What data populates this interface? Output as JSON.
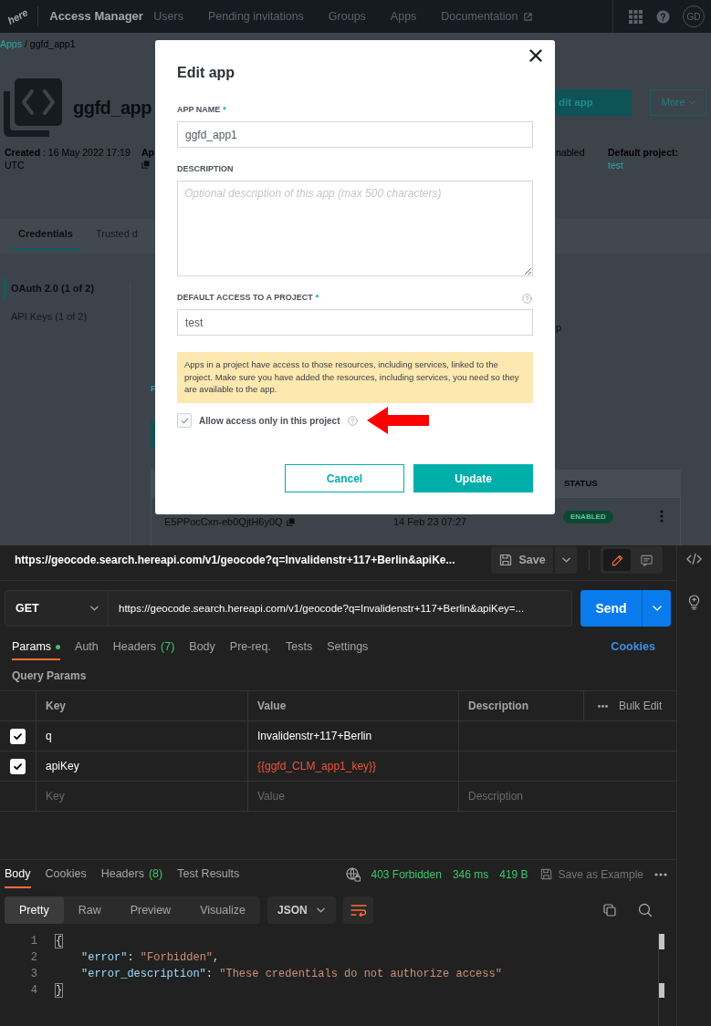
{
  "access_manager": {
    "nav": {
      "logo": "here",
      "title": "Access Manager",
      "links": [
        {
          "label": "Users",
          "external": false
        },
        {
          "label": "Pending invitations",
          "external": false
        },
        {
          "label": "Groups",
          "external": false
        },
        {
          "label": "Apps",
          "external": false
        },
        {
          "label": "Documentation",
          "external": true
        }
      ],
      "avatar": "GD"
    },
    "breadcrumb": {
      "items": [
        "Apps",
        "ggfd_app1"
      ],
      "separator": "/"
    },
    "app": {
      "title": "ggfd_app",
      "buttons": [
        {
          "label": "dit app",
          "kind": "primary"
        },
        {
          "label": "More",
          "kind": "menu"
        }
      ]
    },
    "meta": {
      "created": "**Created** : 16 May 2022 17:19 UTC",
      "column_2": "Ap",
      "column_3": "nabled",
      "default_project_label": "Default project:",
      "default_project": "test"
    },
    "tabs": [
      {
        "label": "Credentials",
        "selected": true
      },
      {
        "label": "Trusted d",
        "selected": false
      }
    ],
    "credential_types": [
      {
        "label": "OAuth 2.0 (1 of 2)",
        "selected": true
      },
      {
        "label": "API Keys (1 of 2)",
        "selected": false
      }
    ],
    "panel": {
      "heading": "F",
      "text": "p"
    },
    "table": {
      "columns": [
        "STATUS"
      ],
      "rows": [
        {
          "column_1": "E5PPocCxn-eb0QjtH6y0Q",
          "column_2": "14 Feb 23 07:27",
          "status": "ENABLED"
        }
      ]
    }
  },
  "dialog": {
    "title": "Edit app",
    "fields": [
      {
        "kind": "text",
        "label": "APP NAME",
        "required_mark": "*",
        "help": false,
        "value": "ggfd_app1"
      },
      {
        "kind": "textarea",
        "label": "DESCRIPTION",
        "help": false,
        "placeholder": "Optional description of this app (max 500 characters)"
      },
      {
        "kind": "text",
        "label": "DEFAULT ACCESS TO A PROJECT",
        "required_mark": "*",
        "help": true,
        "value": "test"
      }
    ],
    "notice": "Apps in a project have access to those resources, including services, linked to the project. Make sure you have added the resources, including services, you need so they are available to the app.",
    "checkbox": {
      "label": "Allow access only in this project",
      "checked": true,
      "disabled": true,
      "help": true
    },
    "annotations": [
      {
        "kind": "arrow"
      }
    ],
    "buttons": [
      {
        "label": "Cancel",
        "kind": "secondary"
      },
      {
        "label": "Update",
        "kind": "primary"
      }
    ]
  },
  "postman": {
    "request_title": "https://geocode.search.hereapi.com/v1/geocode?q=Invalidenstr+117+Berlin&apiKe...",
    "save_button": "Save",
    "view_modes": [
      {
        "kind": "edit",
        "selected": true
      },
      {
        "kind": "comments",
        "selected": false
      }
    ],
    "method": "GET",
    "url": "https://geocode.search.hereapi.com/v1/geocode?q=Invalidenstr+117+Berlin&apiKey=...",
    "send_button": "Send",
    "tabs": [
      {
        "label": "Params",
        "selected": true,
        "modified": true
      },
      {
        "label": "Auth",
        "selected": false,
        "modified": false
      },
      {
        "label": "Headers",
        "count": "(7)",
        "selected": false,
        "modified": false
      },
      {
        "label": "Body",
        "selected": false,
        "modified": false
      },
      {
        "label": "Pre-req.",
        "selected": false,
        "modified": false
      },
      {
        "label": "Tests",
        "selected": false,
        "modified": false
      },
      {
        "label": "Settings",
        "selected": false,
        "modified": false
      }
    ],
    "cookies_link": "Cookies",
    "query_params": {
      "title": "Query Params",
      "columns": [
        "Key",
        "Value",
        "Description"
      ],
      "bulk_edit": "Bulk Edit",
      "rows": [
        {
          "checked": true,
          "key": "q",
          "value": "Invalidenstr+117+Berlin",
          "kind": "text"
        },
        {
          "checked": true,
          "key": "apiKey",
          "value": "{{ggfd_CLM_app1_key}}",
          "kind": "variable"
        }
      ],
      "new_row": {
        "key_placeholder": "Key",
        "value_placeholder": "Value",
        "description_placeholder": "Description"
      }
    },
    "response": {
      "tabs": [
        {
          "label": "Body",
          "selected": true
        },
        {
          "label": "Cookies",
          "selected": false
        },
        {
          "label": "Headers",
          "count": "(8)",
          "selected": false
        },
        {
          "label": "Test Results",
          "selected": false
        }
      ],
      "status": "403 Forbidden",
      "time": "346 ms",
      "size": "419 B",
      "save_example": {
        "label": "Save as Example",
        "disabled": true
      },
      "views": [
        {
          "label": "Pretty",
          "selected": true
        },
        {
          "label": "Raw",
          "selected": false
        },
        {
          "label": "Preview",
          "selected": false
        },
        {
          "label": "Visualize",
          "selected": false
        }
      ],
      "format": "JSON",
      "lines": [
        {
          "number": "1",
          "indented": false,
          "tokens": [
            {
              "kind": "bracket",
              "text": "{"
            }
          ]
        },
        {
          "number": "2",
          "indented": true,
          "tokens": [
            {
              "kind": "key",
              "text": "\"error\""
            },
            {
              "kind": "punct",
              "text": ": "
            },
            {
              "kind": "string",
              "text": "\"Forbidden\""
            },
            {
              "kind": "punct",
              "text": ","
            }
          ]
        },
        {
          "number": "3",
          "indented": true,
          "tokens": [
            {
              "kind": "key",
              "text": "\"error_description\""
            },
            {
              "kind": "punct",
              "text": ": "
            },
            {
              "kind": "string",
              "text": "\"These credentials do not authorize access\""
            }
          ]
        },
        {
          "number": "4",
          "indented": false,
          "tokens": [
            {
              "kind": "bracket",
              "text": "}"
            }
          ]
        }
      ]
    }
  }
}
